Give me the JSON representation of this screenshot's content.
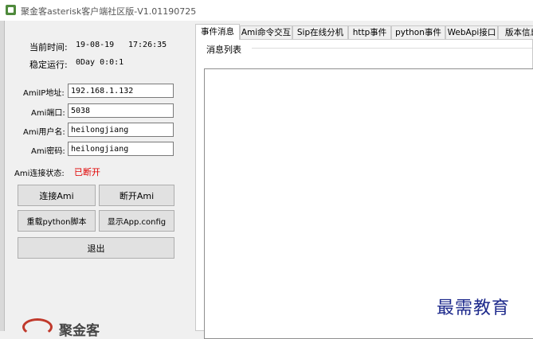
{
  "window": {
    "title": "聚金客asterisk客户端社区版-V1.01190725"
  },
  "left_panel": {
    "current_time_label": "当前时间:",
    "current_date": "19-08-19",
    "current_clock": "17:26:35",
    "uptime_label": "稳定运行:",
    "uptime_value": "0Day 0:0:1",
    "ami_ip_label": "AmiIP地址:",
    "ami_ip_value": "192.168.1.132",
    "ami_port_label": "Ami端口:",
    "ami_port_value": "5038",
    "ami_user_label": "Ami用户名:",
    "ami_user_value": "heilongjiang",
    "ami_password_label": "Ami密码:",
    "ami_password_value": "heilongjiang",
    "status_label": "Ami连接状态:",
    "status_value": "已断开",
    "status_color": "#e00000",
    "buttons": {
      "connect": "连接Ami",
      "disconnect": "断开Ami",
      "reload_python": "重载python脚本",
      "show_config": "显示App.config",
      "exit": "退出"
    },
    "logo_text": "聚金客"
  },
  "tabs": [
    {
      "label": "事件消息",
      "active": true
    },
    {
      "label": "Ami命令交互",
      "active": false
    },
    {
      "label": "Sip在线分机",
      "active": false
    },
    {
      "label": "http事件",
      "active": false
    },
    {
      "label": "python事件",
      "active": false
    },
    {
      "label": "WebApi接口",
      "active": false
    },
    {
      "label": "版本信息",
      "active": false
    }
  ],
  "main_panel": {
    "group_title": "消息列表"
  },
  "watermark": "最需教育"
}
